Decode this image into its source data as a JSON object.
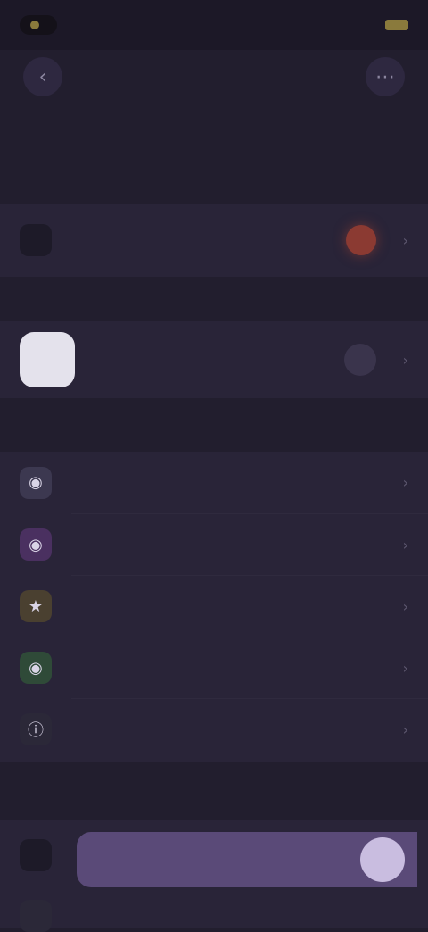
{
  "status_bar": {
    "time": "",
    "right": ""
  },
  "header": {
    "back_icon": "chevron-left-icon",
    "more_icon": "more-icon",
    "title": ""
  },
  "account": {
    "section_label": "",
    "label": "",
    "value": ""
  },
  "profile": {
    "label": "",
    "value": ""
  },
  "preferences": {
    "section_label": "",
    "items": [
      {
        "icon": "bell-icon",
        "color": "#3c3850",
        "label": "",
        "value": ""
      },
      {
        "icon": "palette-icon",
        "color": "#4a3060",
        "label": "",
        "value": ""
      },
      {
        "icon": "star-icon",
        "color": "#4a4030",
        "label": "",
        "value": ""
      },
      {
        "icon": "shield-icon",
        "color": "#2f4a38",
        "label": "",
        "value": ""
      },
      {
        "icon": "info-icon",
        "color": "#2b2838",
        "label": "",
        "value": ""
      }
    ]
  },
  "toggle_section": {
    "section_label": "",
    "toggle_label": "",
    "toggle_on": true,
    "next_label": ""
  },
  "colors": {
    "background": "#221e2e",
    "card": "#292438",
    "accent": "#5a4a78",
    "alert": "#8b3a32"
  }
}
